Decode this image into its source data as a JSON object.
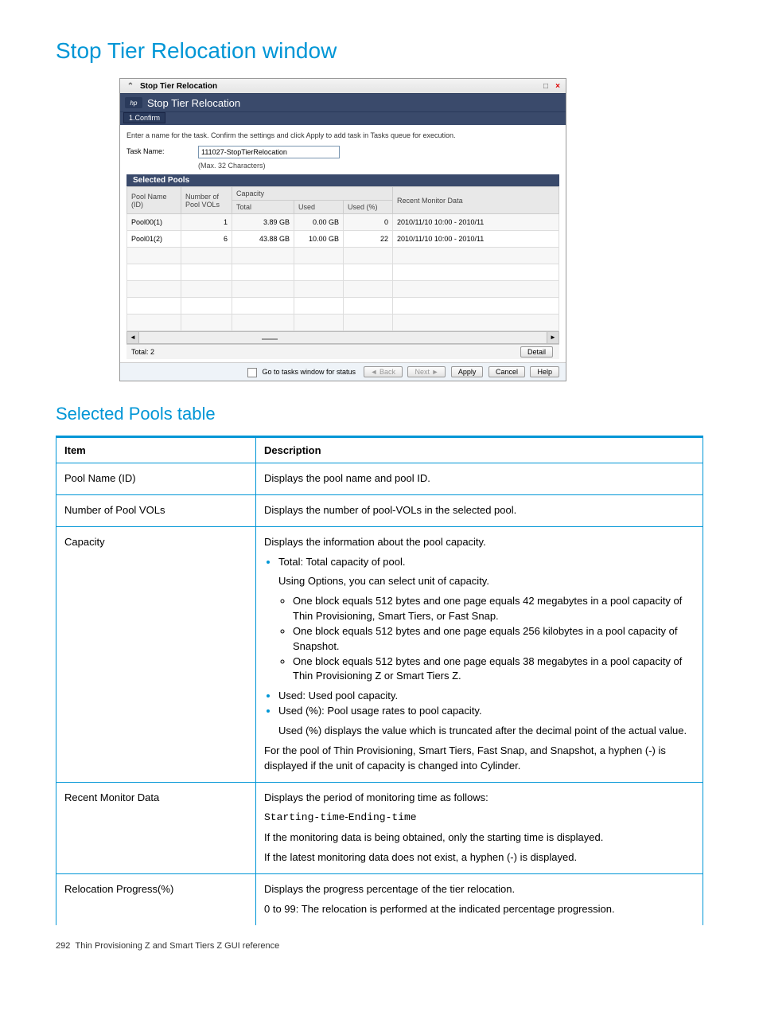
{
  "headings": {
    "h1": "Stop Tier Relocation window",
    "h2": "Selected Pools table"
  },
  "titlebar": {
    "title": "Stop Tier Relocation"
  },
  "header": {
    "logo": "hp",
    "title": "Stop Tier Relocation"
  },
  "tab": "1.Confirm",
  "instruction": "Enter a name for the task. Confirm the settings and click Apply to add task in Tasks queue for execution.",
  "task": {
    "label": "Task Name:",
    "value": "111027-StopTierRelocation",
    "hint": "(Max. 32 Characters)"
  },
  "section": "Selected Pools",
  "cols": {
    "pool": "Pool Name (ID)",
    "vols": "Number of Pool VOLs",
    "cap": "Capacity",
    "total": "Total",
    "used": "Used",
    "usedp": "Used (%)",
    "rmd": "Recent Monitor Data"
  },
  "rows": [
    {
      "pool": "Pool00(1)",
      "vols": "1",
      "total": "3.89 GB",
      "used": "0.00 GB",
      "usedp": "0",
      "rmd": "2010/11/10 10:00 - 2010/11"
    },
    {
      "pool": "Pool01(2)",
      "vols": "6",
      "total": "43.88 GB",
      "used": "10.00 GB",
      "usedp": "22",
      "rmd": "2010/11/10 10:00 - 2010/11"
    }
  ],
  "footer": {
    "total": "Total: 2",
    "detail": "Detail"
  },
  "btns": {
    "go": "Go to tasks window for status",
    "back": "Back",
    "next": "Next",
    "apply": "Apply",
    "cancel": "Cancel",
    "help": "Help"
  },
  "ref": {
    "hItem": "Item",
    "hDesc": "Description",
    "r": [
      {
        "item": "Pool Name (ID)",
        "plain": "Displays the pool name and pool ID."
      },
      {
        "item": "Number of Pool VOLs",
        "plain": "Displays the number of pool-VOLs in the selected pool."
      },
      {
        "item": "Capacity",
        "cap": {
          "intro": "Displays the information about the pool capacity.",
          "b1a": "Total: Total capacity of pool.",
          "b1b": "Using Options, you can select unit of capacity.",
          "s1": "One block equals 512 bytes and one page equals 42 megabytes in a pool capacity of Thin Provisioning, Smart Tiers, or Fast Snap.",
          "s2": "One block equals 512 bytes and one page equals 256 kilobytes in a pool capacity of Snapshot.",
          "s3": "One block equals 512 bytes and one page equals 38 megabytes in a pool capacity of Thin Provisioning Z or Smart Tiers Z.",
          "b2": "Used: Used pool capacity.",
          "b3a": "Used (%): Pool usage rates to pool capacity.",
          "b3b": "Used (%) displays the value which is truncated after the decimal point of the actual value.",
          "tail": "For the pool of Thin Provisioning, Smart Tiers, Fast Snap, and Snapshot, a hyphen (-) is displayed if the unit of capacity is changed into Cylinder."
        }
      },
      {
        "item": "Recent Monitor Data",
        "rmd": {
          "l1": "Displays the period of monitoring time as follows:",
          "l2a": "Starting-time",
          "l2b": "Ending-time",
          "l3": "If the monitoring data is being obtained, only the starting time is displayed.",
          "l4": "If the latest monitoring data does not exist, a hyphen (-) is displayed."
        }
      },
      {
        "item": "Relocation Progress(%)",
        "rp": {
          "l1": "Displays the progress percentage of the tier relocation.",
          "l2": "0 to 99: The relocation is performed at the indicated percentage progression."
        }
      }
    ]
  },
  "pagefoot": {
    "num": "292",
    "txt": "Thin Provisioning Z and Smart Tiers Z GUI reference"
  }
}
